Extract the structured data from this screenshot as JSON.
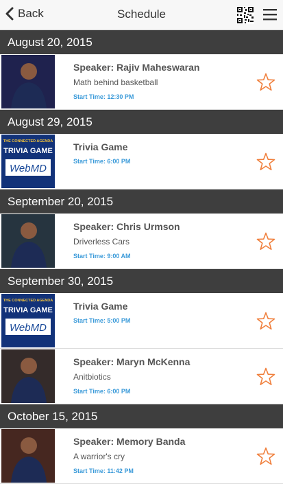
{
  "topbar": {
    "back_label": "Back",
    "title": "Schedule"
  },
  "start_prefix": "Start Time: ",
  "star_color": "#f07f3c",
  "link_color": "#3a9ad9",
  "groups": [
    {
      "date": "August 20, 2015",
      "events": [
        {
          "title": "Speaker: Rajiv Maheswaran",
          "subtitle": "Math behind basketball",
          "time": "Start Time: 12:30 PM",
          "thumb": "speaker-photo"
        }
      ]
    },
    {
      "date": "August 29, 2015",
      "events": [
        {
          "title": "Trivia Game",
          "time": "Start Time: 6:00 PM",
          "thumb": "trivia-logo",
          "logo_top": "THE CONNECTED AGENDA",
          "logo_mid": "TRIVIA GAME",
          "logo_brand": "WebMD"
        }
      ]
    },
    {
      "date": "September 20, 2015",
      "events": [
        {
          "title": "Speaker: Chris Urmson",
          "subtitle": "Driverless Cars",
          "time": "Start Time: 9:00 AM",
          "thumb": "speaker-photo"
        }
      ]
    },
    {
      "date": "September 30, 2015",
      "events": [
        {
          "title": "Trivia Game",
          "time": "Start Time: 5:00 PM",
          "thumb": "trivia-logo",
          "logo_top": "THE CONNECTED AGENDA",
          "logo_mid": "TRIVIA GAME",
          "logo_brand": "WebMD"
        },
        {
          "title": "Speaker: Maryn McKenna",
          "subtitle": "Anitbiotics",
          "time": "Start Time: 6:00 PM",
          "thumb": "speaker-photo"
        }
      ]
    },
    {
      "date": "October 15, 2015",
      "events": [
        {
          "title": "Speaker: Memory Banda",
          "subtitle": "A warrior's cry",
          "time": "Start Time: 11:42 PM",
          "thumb": "speaker-photo"
        }
      ]
    }
  ]
}
